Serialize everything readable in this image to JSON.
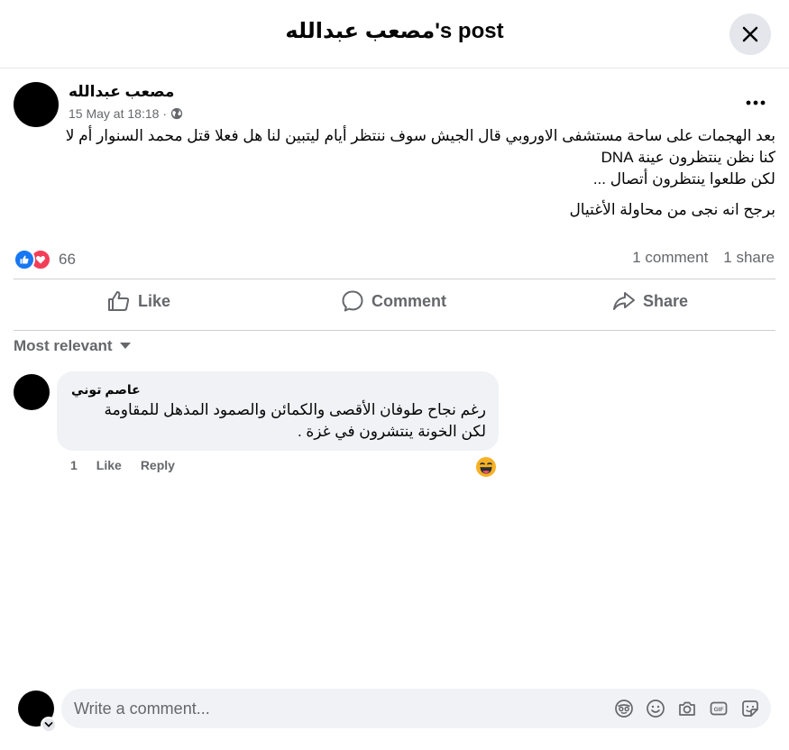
{
  "header": {
    "title": "مصعب عبدالله's post"
  },
  "post": {
    "author": "مصعب عبدالله",
    "timestamp": "15 May at 18:18",
    "separator": "·",
    "audience_icon": "globe-icon",
    "paragraphs": [
      "بعد الهجمات على ساحة مستشفى الاوروبي قال الجيش سوف ننتظر أيام ليتبين لنا هل فعلا قتل محمد السنوار أم لا",
      "كنا نظن ينتظرون عينة DNA",
      "لكن طلعوا ينتظرون أتصال ...",
      "برجح انه نجى من محاولة الأغتيال"
    ],
    "reaction_icons": [
      "like-icon",
      "love-icon"
    ],
    "reaction_count": "66",
    "comments_count": "1 comment",
    "shares_count": "1 share"
  },
  "actions": {
    "like": "Like",
    "comment": "Comment",
    "share": "Share"
  },
  "sort": {
    "label": "Most relevant"
  },
  "comment": {
    "author": "عاصم توني",
    "text_lines": [
      "رغم نجاح طوفان الأقصى والكمائن والصمود المذهل للمقاومة",
      "لكن الخونة ينتشرون في غزة ."
    ],
    "time": "1",
    "like": "Like",
    "reply": "Reply",
    "reaction_icon": "laughing-emoji-icon"
  },
  "composer": {
    "placeholder": "Write a comment...",
    "icons": [
      "avatar-sticker-icon",
      "emoji-icon",
      "camera-icon",
      "gif-icon",
      "sticker-icon"
    ]
  },
  "colors": {
    "primary_text": "#050505",
    "secondary_text": "#65676b",
    "like_blue": "#1877f2",
    "love_red": "#f33e58",
    "bubble_bg": "#f0f2f5",
    "button_bg": "#e4e6eb"
  }
}
